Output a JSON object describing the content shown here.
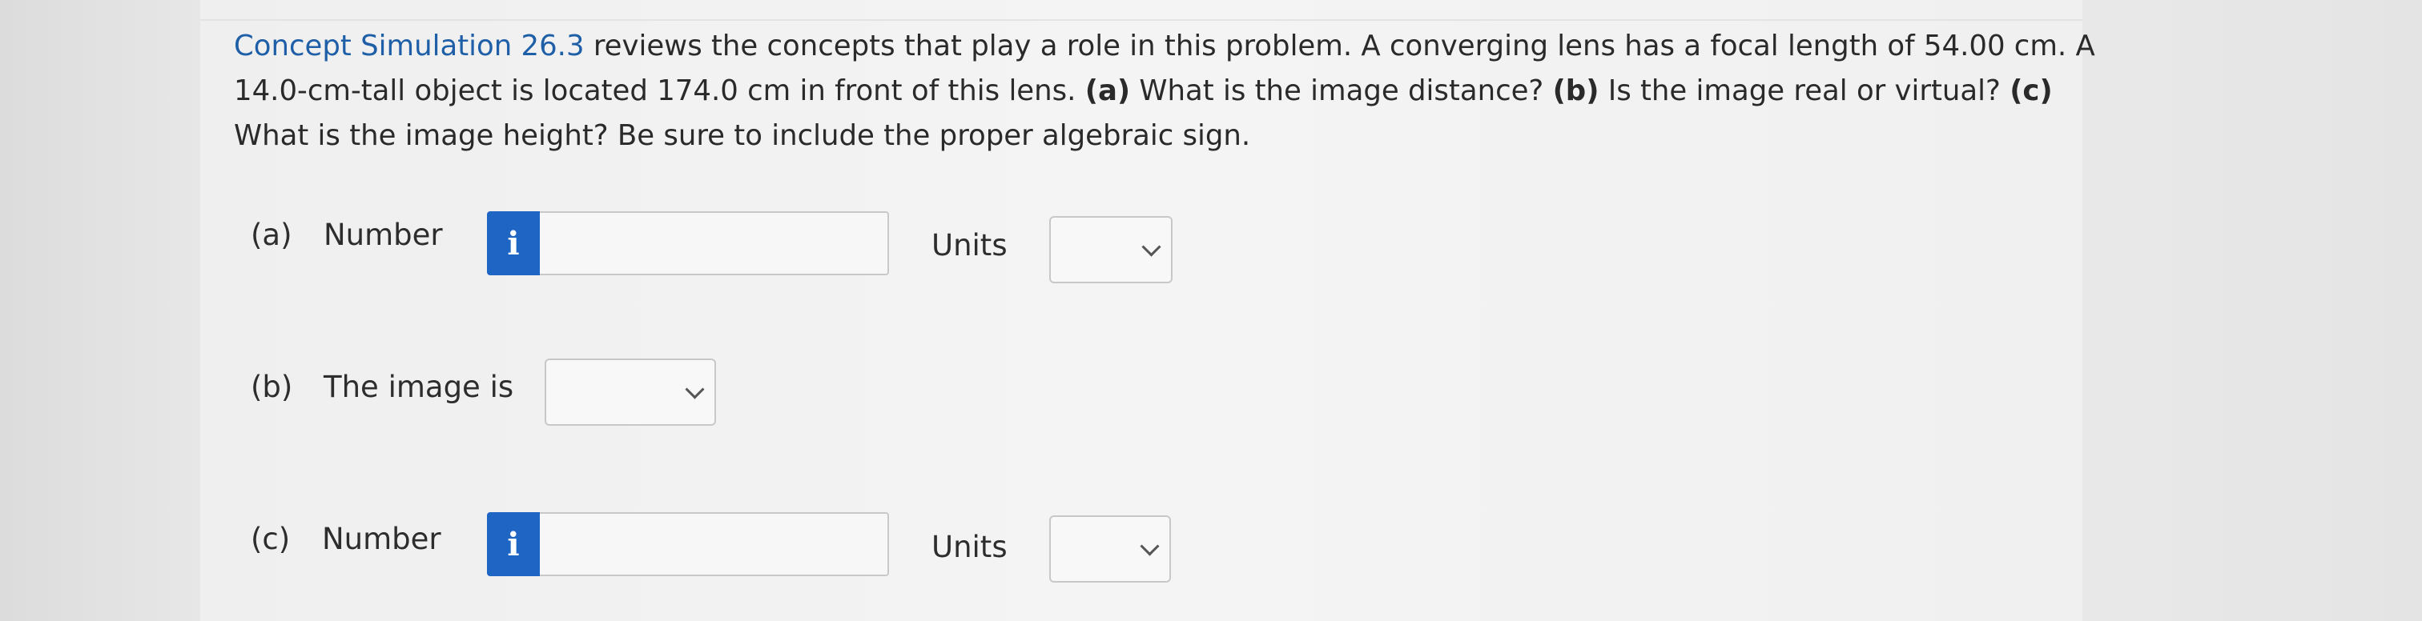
{
  "question": {
    "link_text": "Concept Simulation 26.3",
    "p1": " reviews the concepts that play a role in this problem. A converging lens has a focal length of 54.00 cm. A 14.0-cm-tall object is located 174.0 cm in front of this lens. ",
    "a_tag": "(a)",
    "a_text": " What is the image distance? ",
    "b_tag": "(b)",
    "b_text": " Is the image real or virtual? ",
    "c_tag": "(c)",
    "c_text": " What is the image height? Be sure to include the proper algebraic sign."
  },
  "part_a": {
    "tag": "(a)",
    "label": "Number",
    "info_icon": "i",
    "value": "",
    "units_label": "Units",
    "units_value": ""
  },
  "part_b": {
    "tag": "(b)",
    "label": "The image is",
    "value": ""
  },
  "part_c": {
    "tag": "(c)",
    "label": "Number",
    "info_icon": "i",
    "value": "",
    "units_label": "Units",
    "units_value": ""
  }
}
